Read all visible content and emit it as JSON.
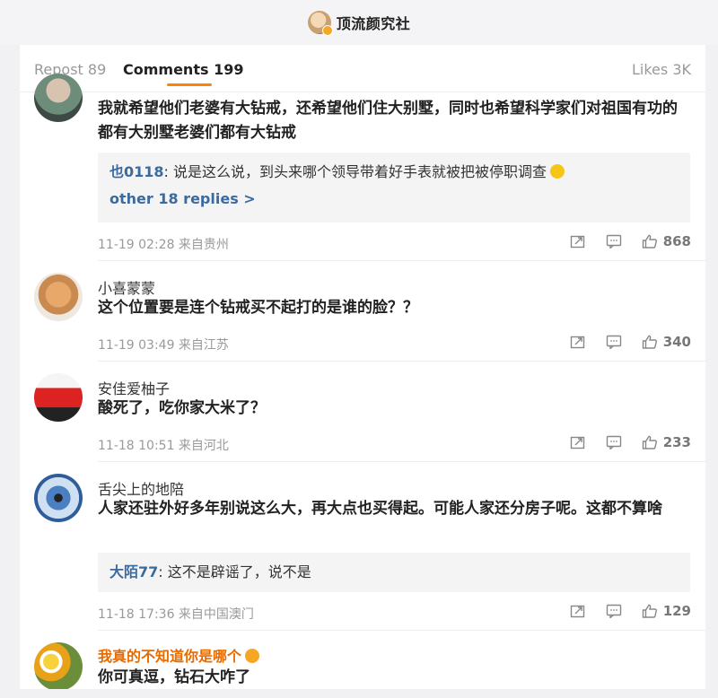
{
  "header": {
    "title": "顶流颜究社"
  },
  "tabs": {
    "repost": "Repost 89",
    "comments": "Comments 199",
    "likes": "Likes 3K"
  },
  "comments": [
    {
      "name": "",
      "text": "我就希望他们老婆有大钻戒，还希望他们住大别墅，同时也希望科学家们对祖国有功的都有大别墅老婆们都有大钻戒",
      "reply": {
        "user": "也0118",
        "text": "说是这么说，到头来哪个领导带着好手表就被把被停职调查",
        "more": "other 18 replies >"
      },
      "meta": "11-19 02:28 来自贵州",
      "likes": "868"
    },
    {
      "name": "小喜蒙蒙",
      "text": "这个位置要是连个钻戒买不起打的是谁的脸？？",
      "meta": "11-19 03:49 来自江苏",
      "likes": "340"
    },
    {
      "name": "安佳爱柚子",
      "text": "酸死了，吃你家大米了？",
      "meta": "11-18 10:51 来自河北",
      "likes": "233"
    },
    {
      "name": "舌尖上的地陪",
      "text": "人家还驻外好多年别说这么大，再大点也买得起。可能人家还分房子呢。这都不算啥",
      "reply": {
        "user": "大陌77",
        "text": "这不是辟谣了，说不是"
      },
      "meta": "11-18 17:36 来自中国澳门",
      "likes": "129"
    },
    {
      "name": "我真的不知道你是哪个",
      "text": "你可真逗，钻石大咋了"
    }
  ],
  "colors": {
    "accent": "#ff8200",
    "link": "#3b6aa0",
    "vip_name": "#e86b00"
  },
  "icons": [
    "share-icon",
    "comment-icon",
    "thumbs-up-icon"
  ]
}
